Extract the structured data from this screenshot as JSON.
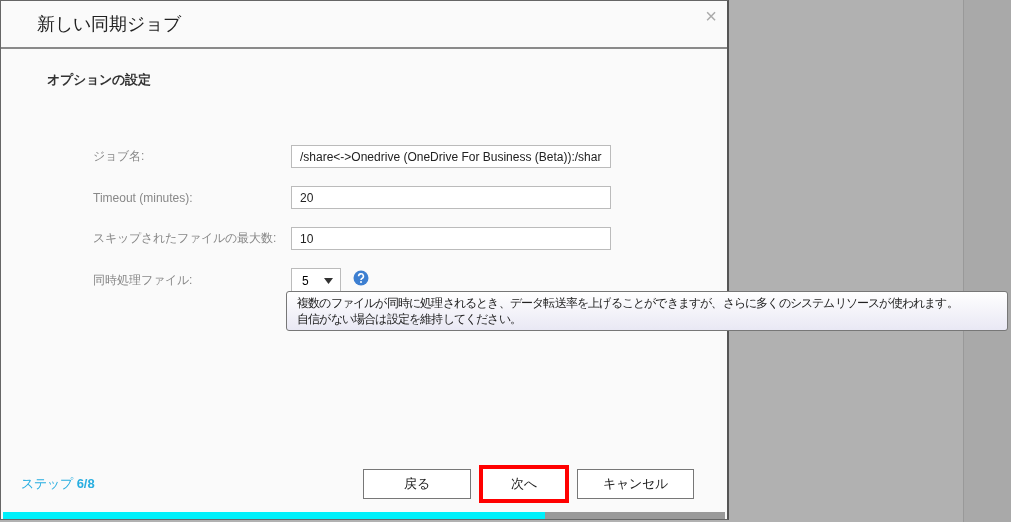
{
  "dialog": {
    "title": "新しい同期ジョブ",
    "close": "×",
    "section": "オプションの設定",
    "fields": [
      {
        "kind": "text",
        "label": "ジョブ名:",
        "value": "/share<->Onedrive (OneDrive For Business (Beta)):/shar"
      },
      {
        "kind": "text",
        "label": "Timeout (minutes):",
        "value": "20"
      },
      {
        "kind": "text",
        "label": "スキップされたファイルの最大数:",
        "value": "10"
      },
      {
        "kind": "select",
        "label": "同時処理ファイル:",
        "value": "5",
        "help": true
      }
    ],
    "tooltip": [
      "複数のファイルが同時に処理されるとき、データ転送率を上げることができますが、さらに多くのシステムリソースが使われます。",
      "自信がない場合は設定を維持してください。"
    ],
    "step": {
      "label": "ステップ",
      "value": "6/8"
    },
    "buttons": [
      {
        "label": "戻る",
        "highlighted": false
      },
      {
        "label": "次へ",
        "highlighted": true
      },
      {
        "label": "キャンセル",
        "highlighted": false
      }
    ],
    "progress": {
      "level": 0.75
    }
  }
}
